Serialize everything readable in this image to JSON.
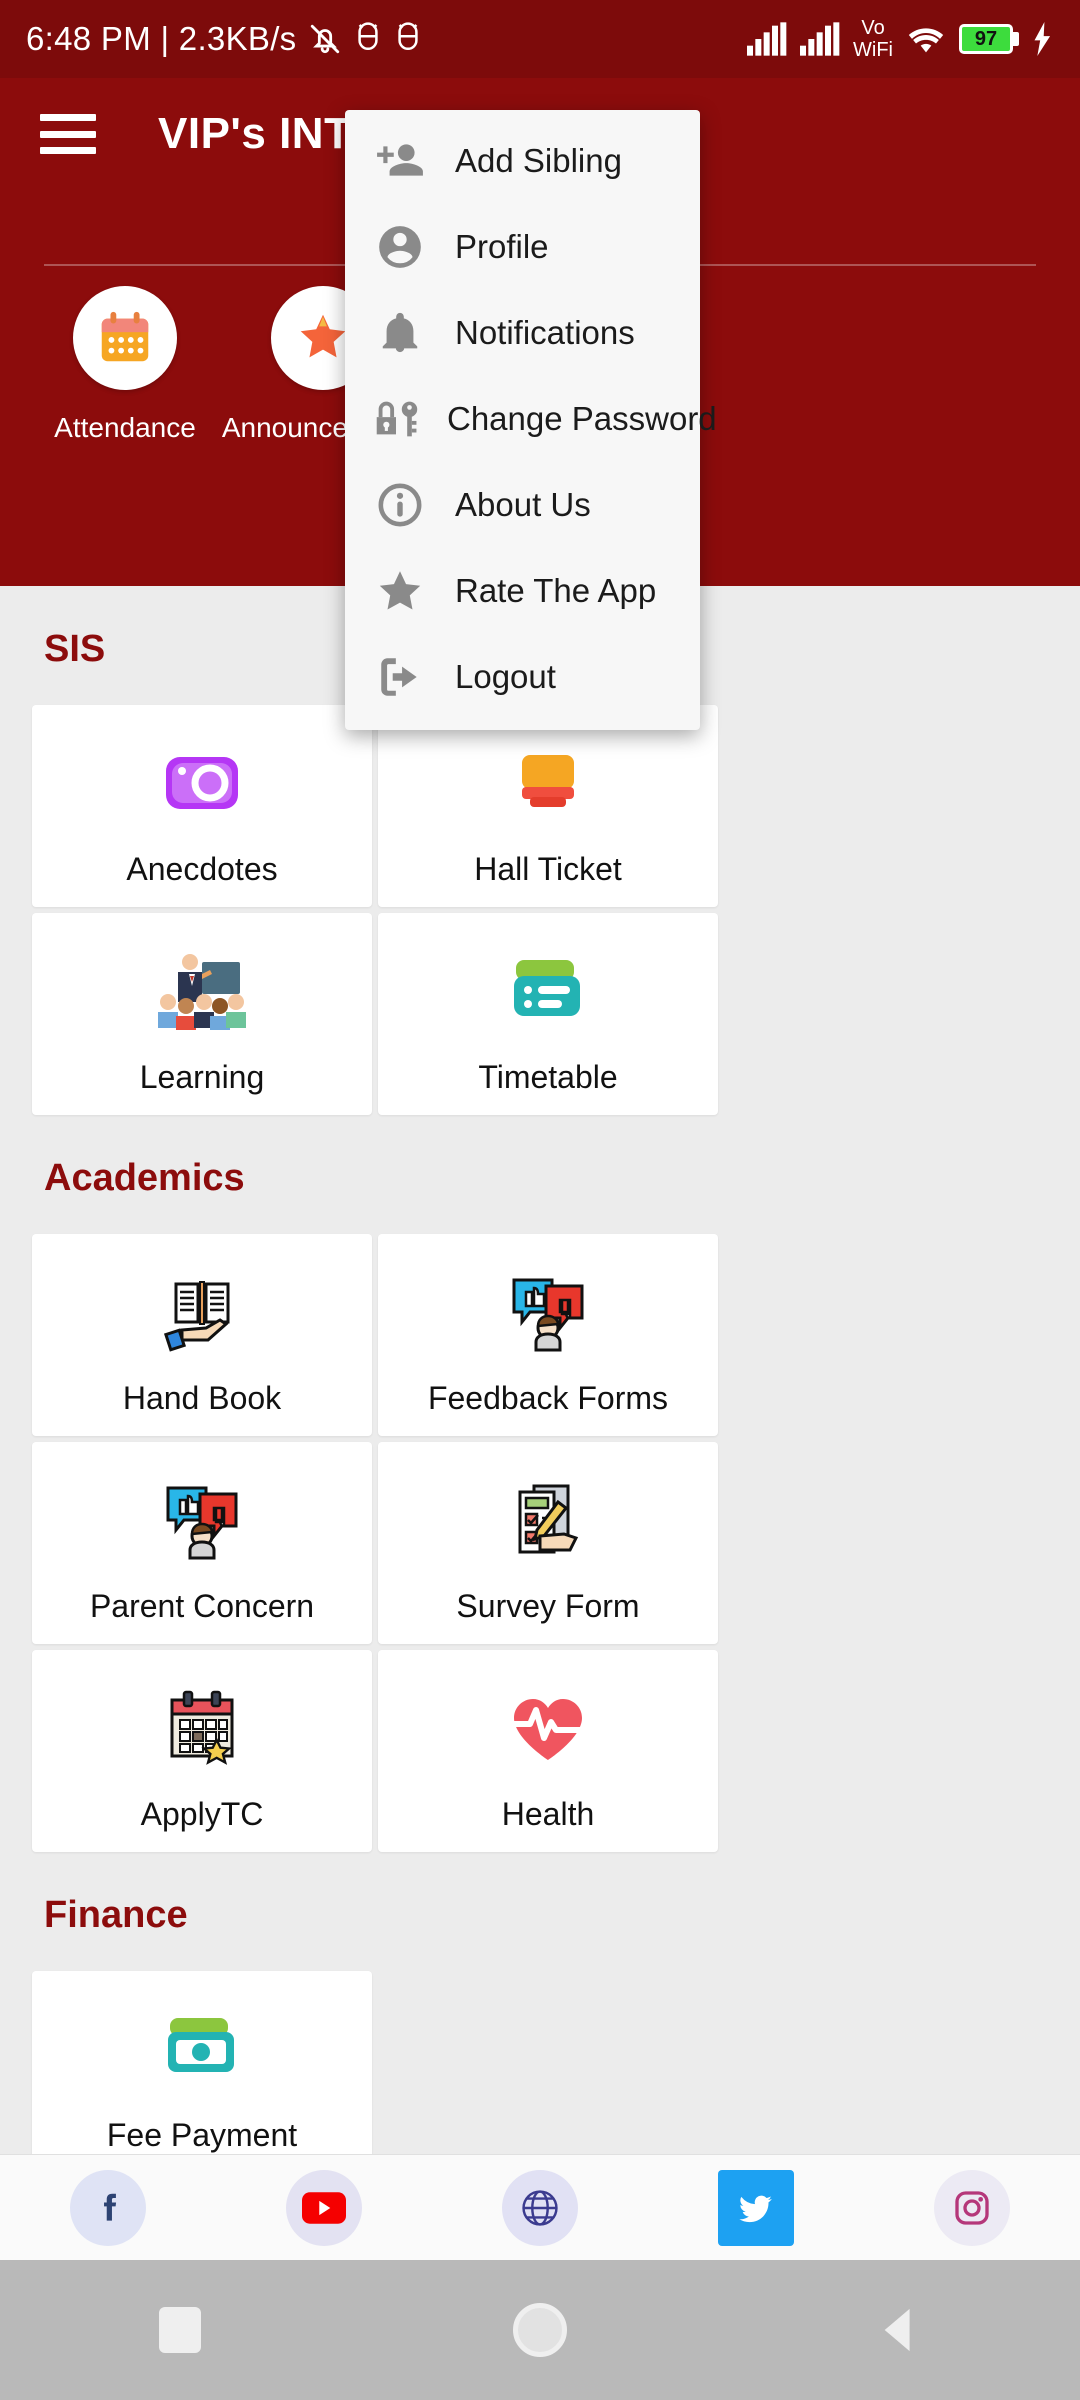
{
  "status_bar": {
    "time": "6:48 PM | 2.3KB/s",
    "icons": [
      "mute-icon",
      "alarm-icon",
      "alarm-icon"
    ],
    "right_icons": [
      "signal-bars-icon",
      "signal-bars-icon",
      "volte-wifi-icon",
      "wifi-icon"
    ],
    "volte_label_top": "Vo",
    "volte_label_bottom": "WiFi",
    "battery_percent": "97",
    "charging": true
  },
  "header": {
    "menu_icon": "hamburger-icon",
    "title": "VIP's INTERNATIONAL",
    "background_color": "#8c0c0c",
    "shortcuts": [
      {
        "label": "Attendance",
        "icon": "calendar-icon"
      },
      {
        "label": "Announcements",
        "icon": "star-icon"
      }
    ]
  },
  "dropdown_menu": {
    "visible": true,
    "items": [
      {
        "label": "Add Sibling",
        "icon": "person-add-icon"
      },
      {
        "label": "Profile",
        "icon": "account-circle-icon"
      },
      {
        "label": "Notifications",
        "icon": "bell-icon"
      },
      {
        "label": "Change Password",
        "icon": "lock-key-icon"
      },
      {
        "label": "About Us",
        "icon": "info-circle-icon"
      },
      {
        "label": "Rate The App",
        "icon": "star-icon"
      },
      {
        "label": "Logout",
        "icon": "logout-icon"
      }
    ]
  },
  "sections": [
    {
      "title": "SIS",
      "accent_color": "#8c0c0c",
      "items": [
        {
          "label": "Anecdotes",
          "icon": "camera-icon"
        },
        {
          "label": "Hall Ticket",
          "icon": "ticket-icon"
        },
        {
          "label": "Learning",
          "icon": "classroom-icon"
        },
        {
          "label": "Timetable",
          "icon": "list-card-icon"
        }
      ]
    },
    {
      "title": "Academics",
      "accent_color": "#8c0c0c",
      "items": [
        {
          "label": "Hand Book",
          "icon": "open-book-hand-icon"
        },
        {
          "label": "Feedback Forms",
          "icon": "feedback-bubbles-icon"
        },
        {
          "label": "Parent Concern",
          "icon": "feedback-bubbles-icon"
        },
        {
          "label": "Survey Form",
          "icon": "checklist-pen-icon"
        },
        {
          "label": "ApplyTC",
          "icon": "calendar-star-icon"
        },
        {
          "label": "Health",
          "icon": "heartbeat-icon"
        }
      ]
    },
    {
      "title": "Finance",
      "accent_color": "#8c0c0c",
      "items": [
        {
          "label": "Fee Payment",
          "icon": "money-icon"
        }
      ]
    }
  ],
  "social_bar": {
    "items": [
      {
        "name": "facebook",
        "icon": "facebook-icon"
      },
      {
        "name": "youtube",
        "icon": "youtube-icon"
      },
      {
        "name": "website",
        "icon": "globe-icon"
      },
      {
        "name": "twitter",
        "icon": "twitter-icon"
      },
      {
        "name": "instagram",
        "icon": "instagram-icon"
      }
    ]
  },
  "nav_bar": {
    "buttons": [
      {
        "name": "recents",
        "icon": "square-icon"
      },
      {
        "name": "home",
        "icon": "circle-icon"
      },
      {
        "name": "back",
        "icon": "triangle-back-icon"
      }
    ]
  }
}
